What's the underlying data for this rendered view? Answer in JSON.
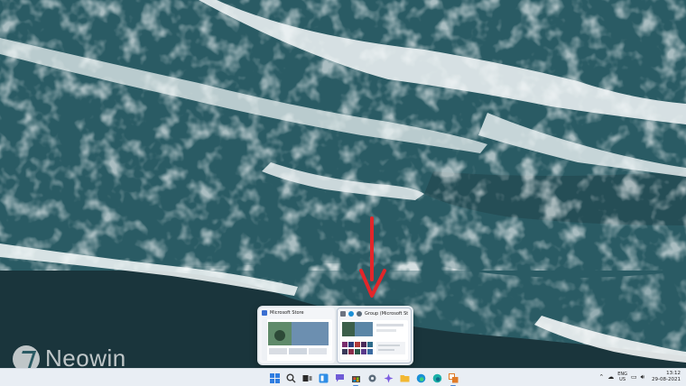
{
  "watermark": {
    "brand": "Neowin"
  },
  "previews": [
    {
      "title": "Microsoft Store",
      "icon": "store-icon"
    },
    {
      "title": "Group (Microsoft Stor...",
      "icon": "group-icon"
    }
  ],
  "taskbar": {
    "apps": [
      {
        "name": "start",
        "icon": "windows-icon",
        "color": "#2f7de1"
      },
      {
        "name": "search",
        "icon": "search-icon",
        "color": "#3a3a3a"
      },
      {
        "name": "task-view",
        "icon": "task-view-icon",
        "color": "#2a2a2a"
      },
      {
        "name": "widgets",
        "icon": "widgets-icon",
        "color": "#2e8de6"
      },
      {
        "name": "chat",
        "icon": "chat-icon",
        "color": "#6f5bd6"
      },
      {
        "name": "microsoft-store",
        "icon": "store-icon",
        "color": "#4a4a4a"
      },
      {
        "name": "settings",
        "icon": "settings-icon",
        "color": "#5b6b7a"
      },
      {
        "name": "copilot",
        "icon": "sparkle-icon",
        "color": "#7b5be0"
      },
      {
        "name": "file-explorer",
        "icon": "folder-icon",
        "color": "#f2b833"
      },
      {
        "name": "edge",
        "icon": "edge-icon",
        "color": "#1a8fd6"
      },
      {
        "name": "edge-beta",
        "icon": "edge-beta-icon",
        "color": "#1bb0a8"
      },
      {
        "name": "group",
        "icon": "group-icon",
        "color": "#e07b28"
      }
    ],
    "tray": {
      "lang_top": "ENG",
      "lang_bottom": "US",
      "time": "13:12",
      "date": "29-08-2021"
    }
  }
}
